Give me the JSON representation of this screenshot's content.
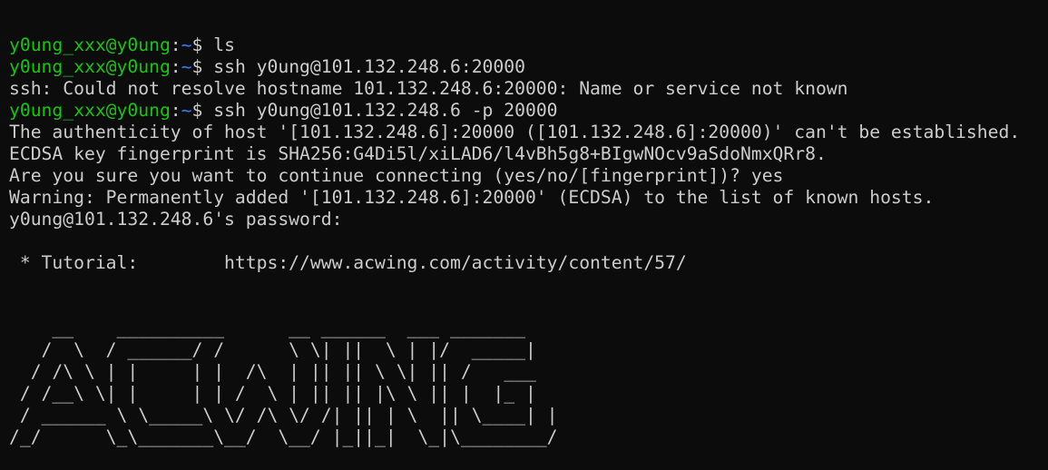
{
  "colors": {
    "background": "#0c0c0c",
    "text": "#cccccc",
    "prompt_user": "#16c60c",
    "prompt_path": "#3b78ff"
  },
  "prompt": {
    "user_host": "y0ung_xxx@y0ung",
    "colon": ":",
    "path": "~",
    "symbol": "$ "
  },
  "lines": [
    {
      "type": "prompt",
      "cmd": "ls"
    },
    {
      "type": "prompt",
      "cmd": "ssh y0ung@101.132.248.6:20000"
    },
    {
      "type": "output",
      "text": "ssh: Could not resolve hostname 101.132.248.6:20000: Name or service not known"
    },
    {
      "type": "prompt",
      "cmd": "ssh y0ung@101.132.248.6 -p 20000"
    },
    {
      "type": "output",
      "text": "The authenticity of host '[101.132.248.6]:20000 ([101.132.248.6]:20000)' can't be established."
    },
    {
      "type": "output",
      "text": "ECDSA key fingerprint is SHA256:G4Di5l/xiLAD6/l4vBh5g8+BIgwNOcv9aSdoNmxQRr8."
    },
    {
      "type": "output",
      "text": "Are you sure you want to continue connecting (yes/no/[fingerprint])? yes"
    },
    {
      "type": "output",
      "text": "Warning: Permanently added '[101.132.248.6]:20000' (ECDSA) to the list of known hosts."
    },
    {
      "type": "output",
      "text": "y0ung@101.132.248.6's password:"
    },
    {
      "type": "output",
      "text": ""
    },
    {
      "type": "output",
      "text": " * Tutorial:        https://www.acwing.com/activity/content/57/"
    }
  ],
  "ascii_art": [
    "    __    __________      __ ______  ___ _______",
    "   /  \\  / ______/ /      \\ \\| ||  \\ | |/  _____|",
    "  / /\\ \\ | |     | |  /\\  | || || \\ \\| || /   ___",
    " / /__\\ \\| |     | | /  \\ | || || |\\ \\ || |  |_ |",
    " / ______ \\ \\_____\\ \\/ /\\ \\/ /| || | \\  || \\____| |",
    "/_/      \\_\\_______\\__/  \\__/ |_||_|  \\_|\\________/"
  ]
}
